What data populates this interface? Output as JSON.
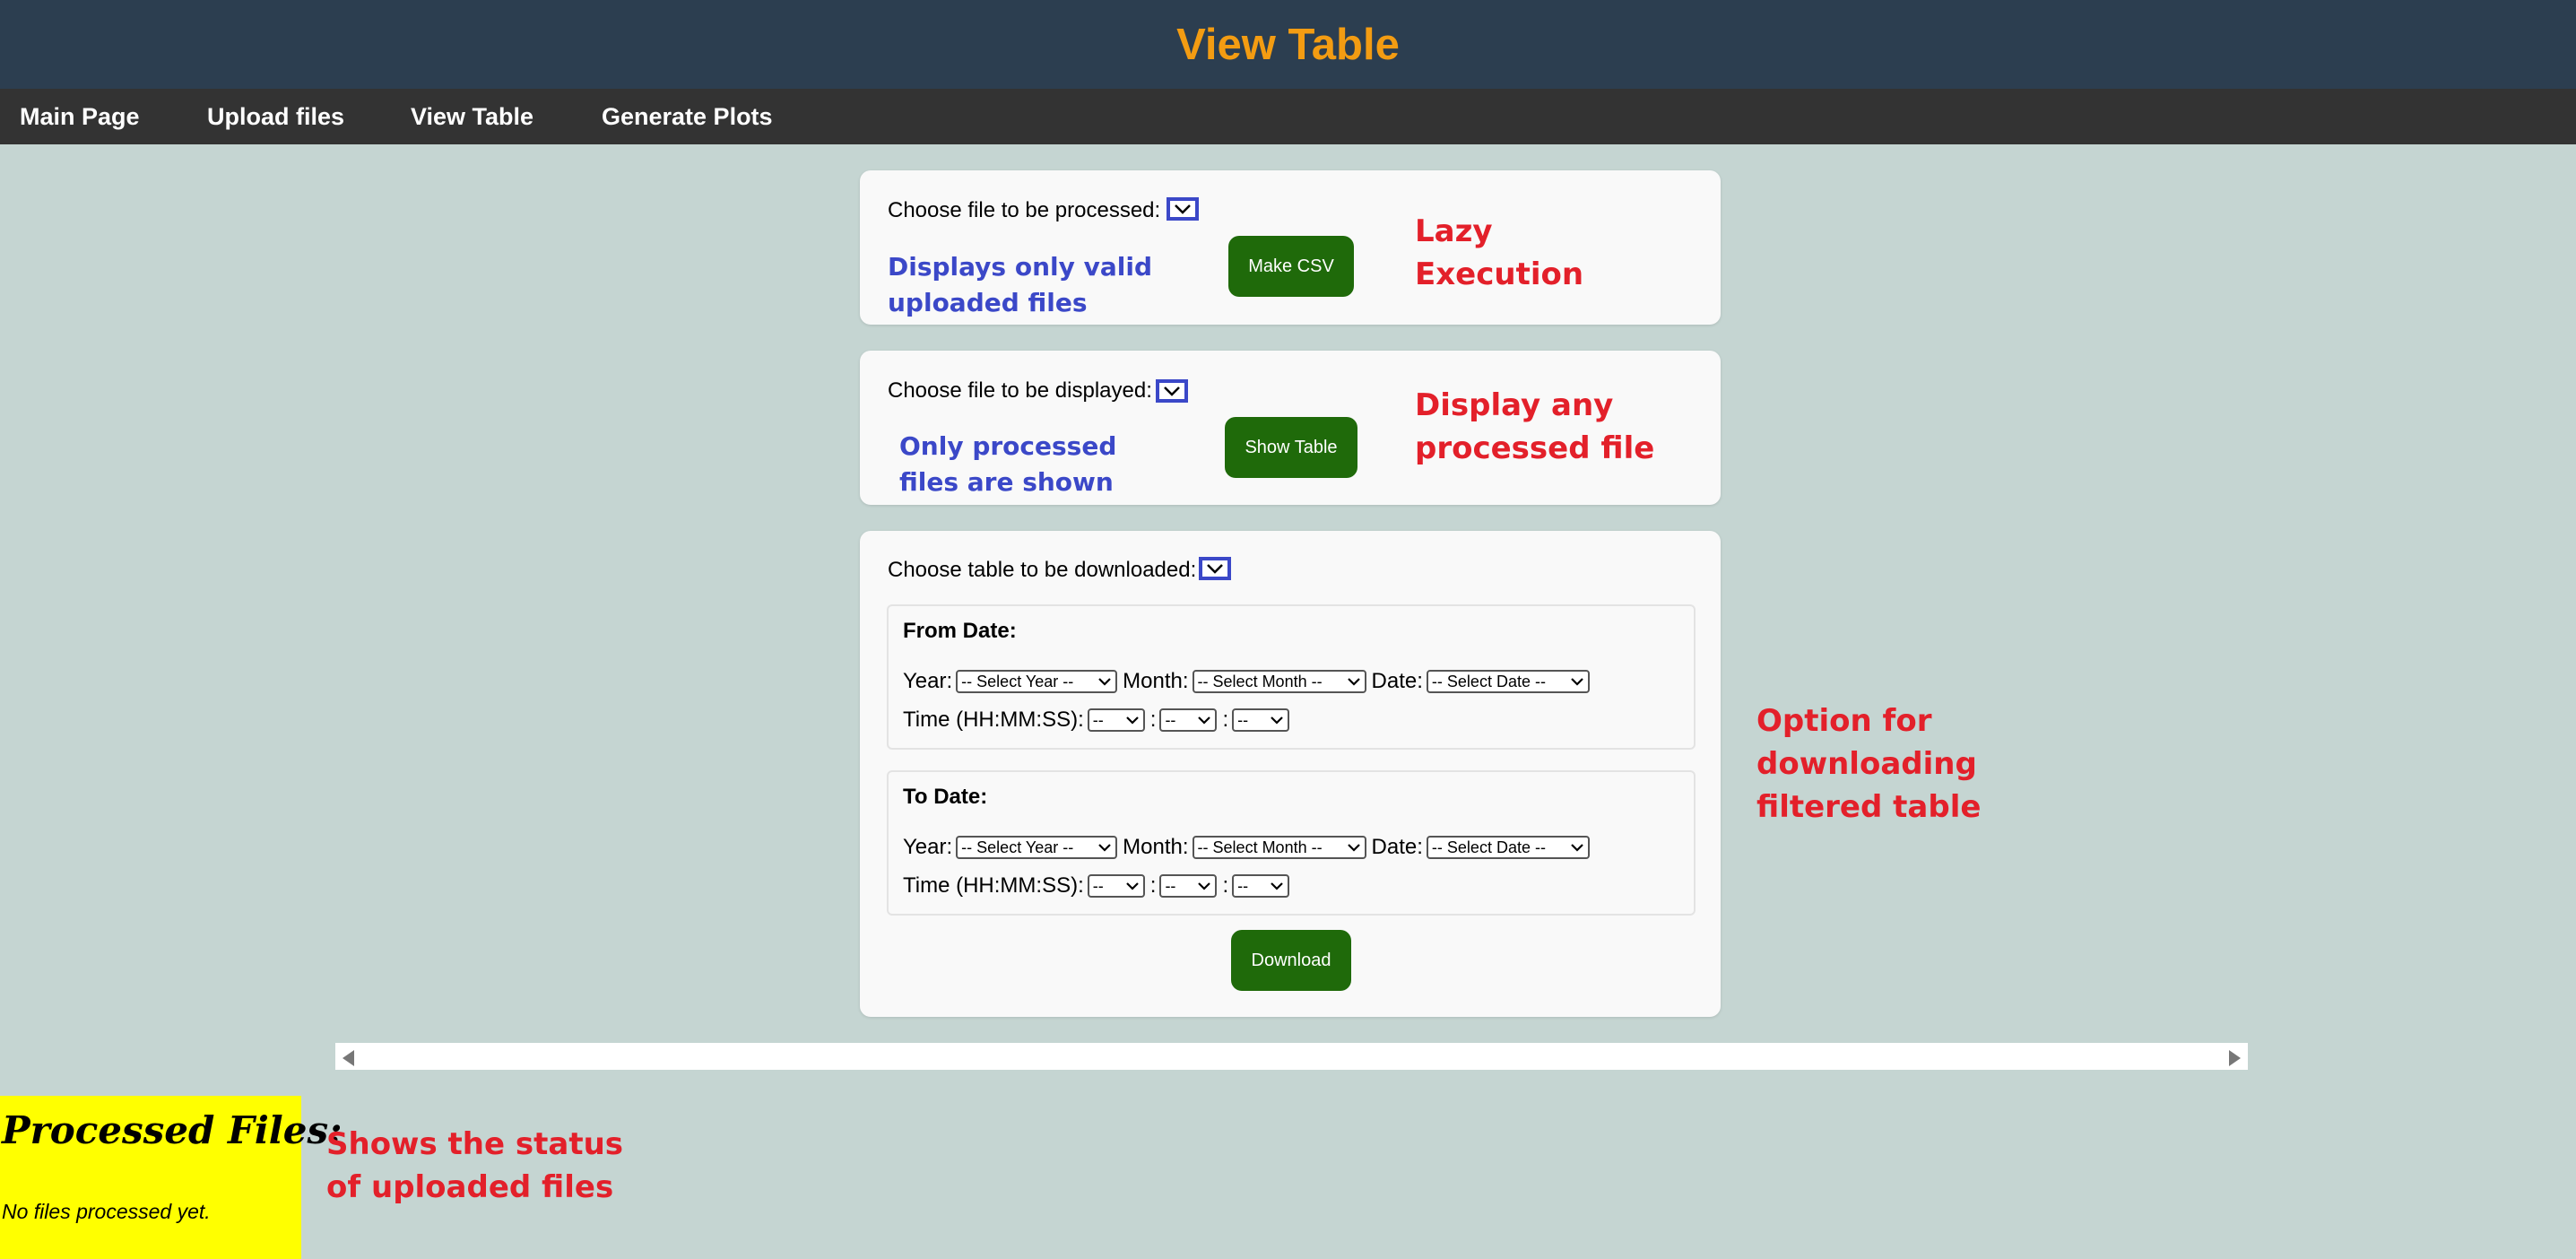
{
  "header": {
    "title": "View Table"
  },
  "nav": {
    "items": [
      "Main Page",
      "Upload files",
      "View Table",
      "Generate Plots"
    ]
  },
  "process": {
    "label": "Choose file to be processed:",
    "button": "Make CSV",
    "note_line1": "Displays only valid",
    "note_line2": "uploaded files",
    "annotation_line1": "Lazy",
    "annotation_line2": "Execution"
  },
  "display": {
    "label": "Choose file to be displayed:",
    "button": "Show Table",
    "note_line1": "Only processed",
    "note_line2": "files are shown",
    "annotation_line1": "Display any",
    "annotation_line2": "processed file"
  },
  "download": {
    "label": "Choose table to be downloaded:",
    "button": "Download",
    "from_title": "From Date:",
    "to_title": "To Date:",
    "year_label": "Year:",
    "month_label": "Month:",
    "date_label": "Date:",
    "time_label": "Time (HH:MM:SS):",
    "colon": ":",
    "year_placeholder": "-- Select Year --",
    "month_placeholder": "-- Select Month --",
    "date_placeholder": "-- Select Date --",
    "time_placeholder": "--",
    "annotation_line1": "Option for",
    "annotation_line2": "downloading",
    "annotation_line3": "filtered table"
  },
  "processed_files": {
    "title": "Processed Files:",
    "empty_text": "No files processed yet.",
    "annotation_line1": "Shows the status",
    "annotation_line2": "of uploaded files"
  },
  "colors": {
    "header_bg": "#2c3e50",
    "title": "#f39c12",
    "nav_bg": "#333333",
    "page_bg": "#c5d5d2",
    "button_bg": "#1f6a0a",
    "annotation_blue": "#3b48c8",
    "annotation_red": "#e3202a",
    "processed_bg": "#ffff00"
  },
  "icons": [
    "chevron-down-icon",
    "scroll-left-arrow-icon",
    "scroll-right-arrow-icon"
  ]
}
